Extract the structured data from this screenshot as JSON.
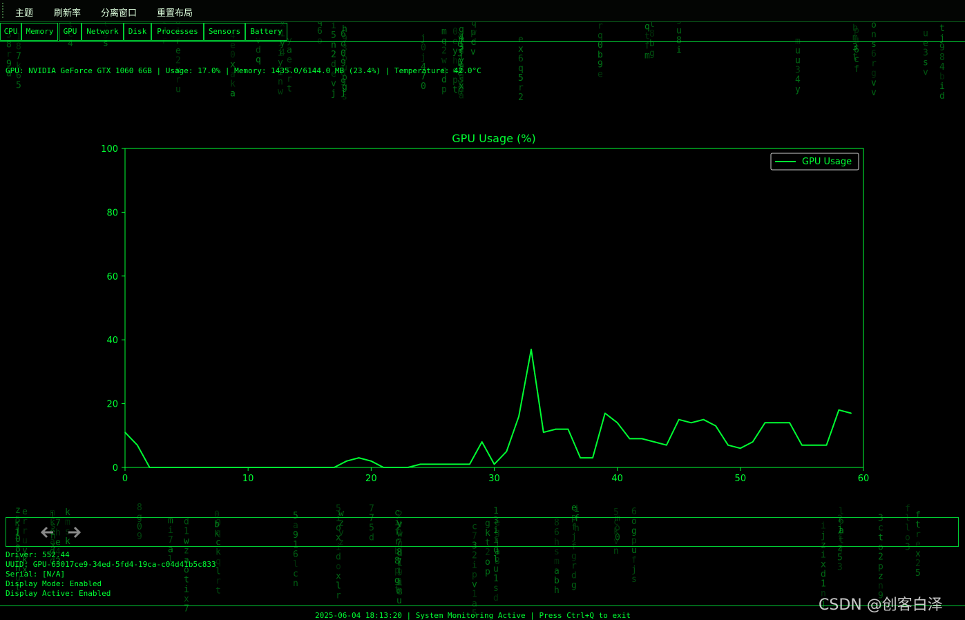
{
  "menu": [
    "主题",
    "刷新率",
    "分离窗口",
    "重置布局"
  ],
  "tabs": [
    {
      "label": "CPU",
      "active": false
    },
    {
      "label": "Memory",
      "active": false
    },
    {
      "label": "GPU",
      "active": true
    },
    {
      "label": "Network",
      "active": false
    },
    {
      "label": "Disk",
      "active": false
    },
    {
      "label": "Processes",
      "active": false
    },
    {
      "label": "Sensors",
      "active": false
    },
    {
      "label": "Battery",
      "active": false
    }
  ],
  "info_line": "GPU: NVIDIA GeForce GTX 1060 6GB | Usage: 17.0% | Memory: 1435.0/6144.0 MB (23.4%) | Temperature: 42.0°C",
  "chart_data": {
    "type": "line",
    "title": "GPU Usage (%)",
    "xlabel": "",
    "ylabel": "",
    "xlim": [
      0,
      60
    ],
    "ylim": [
      0,
      100
    ],
    "xticks": [
      0,
      10,
      20,
      30,
      40,
      50,
      60
    ],
    "yticks": [
      0,
      20,
      40,
      60,
      80,
      100
    ],
    "grid": false,
    "legend": "top-right",
    "color": "#00ff33",
    "series": [
      {
        "name": "GPU Usage",
        "x": [
          0,
          1,
          2,
          3,
          4,
          5,
          6,
          7,
          8,
          9,
          10,
          11,
          12,
          13,
          14,
          15,
          16,
          17,
          18,
          19,
          20,
          21,
          22,
          23,
          24,
          25,
          26,
          27,
          28,
          29,
          30,
          31,
          32,
          33,
          34,
          35,
          36,
          37,
          38,
          39,
          40,
          41,
          42,
          43,
          44,
          45,
          46,
          47,
          48,
          49,
          50,
          51,
          52,
          53,
          54,
          55,
          56,
          57,
          58,
          59
        ],
        "values": [
          11,
          7,
          0,
          0,
          0,
          0,
          0,
          0,
          0,
          0,
          0,
          0,
          0,
          0,
          0,
          0,
          0,
          0,
          2,
          3,
          2,
          0,
          0,
          0,
          1,
          1,
          1,
          1,
          1,
          8,
          1,
          5,
          16,
          37,
          11,
          12,
          12,
          3,
          3,
          17,
          14,
          9,
          9,
          8,
          7,
          15,
          14,
          15,
          13,
          7,
          6,
          8,
          14,
          14,
          14,
          7,
          7,
          7,
          18,
          17
        ]
      }
    ]
  },
  "details": [
    "Driver: 552.44",
    "UUID: GPU-63017ce9-34ed-5fd4-19ca-c04d41b5c833",
    "Serial: [N/A]",
    "Display Mode: Enabled",
    "Display Active: Enabled"
  ],
  "status": "2025-06-04 18:13:20 | System Monitoring Active | Press Ctrl+Q to exit",
  "watermark": "CSDN @创客白泽",
  "colors": {
    "accent": "#00ff33",
    "background": "#000000",
    "active_tab": "#003b12"
  },
  "icons": {
    "back": "arrow-left-icon",
    "forward": "arrow-right-icon"
  }
}
